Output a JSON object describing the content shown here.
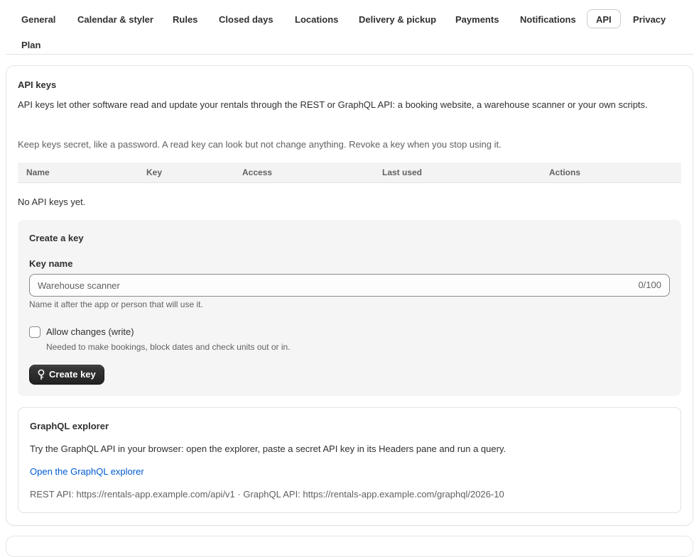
{
  "tabs": [
    {
      "label": "General",
      "active": false
    },
    {
      "label": "Calendar & styler",
      "active": false
    },
    {
      "label": "Rules",
      "active": false
    },
    {
      "label": "Closed days",
      "active": false
    },
    {
      "label": "Locations",
      "active": false
    },
    {
      "label": "Delivery & pickup",
      "active": false
    },
    {
      "label": "Payments",
      "active": false
    },
    {
      "label": "Notifications",
      "active": false
    },
    {
      "label": "API",
      "active": true
    },
    {
      "label": "Privacy",
      "active": false
    },
    {
      "label": "Plan",
      "active": false
    }
  ],
  "api_keys": {
    "title": "API keys",
    "description": "API keys let other software read and update your rentals through the REST or GraphQL API: a booking website, a warehouse scanner or your own scripts.",
    "security_note": "Keep keys secret, like a password. A read key can look but not change anything. Revoke a key when you stop using it.",
    "table": {
      "columns": [
        "Name",
        "Key",
        "Access",
        "Last used",
        "Actions"
      ],
      "rows": [],
      "empty_text": "No API keys yet."
    }
  },
  "create_key": {
    "title": "Create a key",
    "name_label": "Key name",
    "name_placeholder": "Warehouse scanner",
    "name_value": "",
    "char_count": "0/100",
    "name_help": "Name it after the app or person that will use it.",
    "write_label": "Allow changes (write)",
    "write_checked": false,
    "write_help": "Needed to make bookings, block dates and check units out or in.",
    "button_label": "Create key",
    "button_icon": "key-icon"
  },
  "graphql": {
    "title": "GraphQL explorer",
    "description": "Try the GraphQL API in your browser: open the explorer, paste a secret API key in its Headers pane and run a query.",
    "link_label": "Open the GraphQL explorer",
    "endpoints": "REST API: https://rentals-app.example.com/api/v1 · GraphQL API: https://rentals-app.example.com/graphql/2026-10"
  },
  "colors": {
    "link": "#005bd3",
    "primary_button": "#303030",
    "panel_bg": "#f5f5f5",
    "table_header_bg": "#f3f3f3"
  }
}
